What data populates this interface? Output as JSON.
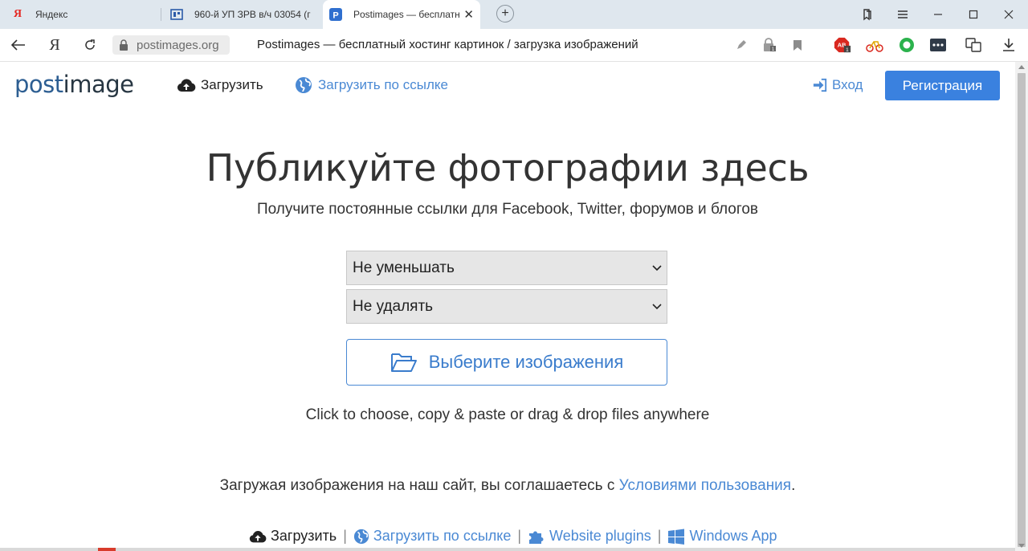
{
  "browser": {
    "tabs": [
      {
        "title": "Яндекс",
        "favicon": "yandex-icon"
      },
      {
        "title": "960-й УП ЗРВ в/ч 03054 (г",
        "favicon": "site-icon"
      },
      {
        "title": "Postimages — бесплатн",
        "favicon": "postimages-icon",
        "active": true
      }
    ],
    "url_domain": "postimages.org",
    "page_title": "Postimages — бесплатный хостинг картинок / загрузка изображений",
    "ext_ab_badge": "AB",
    "ext_count": "1"
  },
  "header": {
    "logo_left": "post",
    "logo_right": "image",
    "nav": {
      "upload": "Загрузить",
      "upload_by_url": "Загрузить по ссылке",
      "login": "Вход",
      "register": "Регистрация"
    }
  },
  "hero": {
    "title": "Публикуйте фотографии здесь",
    "subtitle": "Получите постоянные ссылки для Facebook, Twitter, форумов и блогов"
  },
  "form": {
    "resize_selected": "Не уменьшать",
    "expire_selected": "Не удалять",
    "choose_button": "Выберите изображения",
    "hint": "Click to choose, copy & paste or drag & drop files anywhere"
  },
  "terms": {
    "text": "Загружая изображения на наш сайт, вы соглашаетесь с ",
    "link": "Условиями пользования",
    "end": "."
  },
  "footer": {
    "upload": "Загрузить",
    "upload_by_url": "Загрузить по ссылке",
    "plugins": "Website plugins",
    "windows_app": "Windows App",
    "separator": "|"
  },
  "colors": {
    "accent": "#3a81df",
    "link": "#4a89d4",
    "text": "#333333"
  }
}
